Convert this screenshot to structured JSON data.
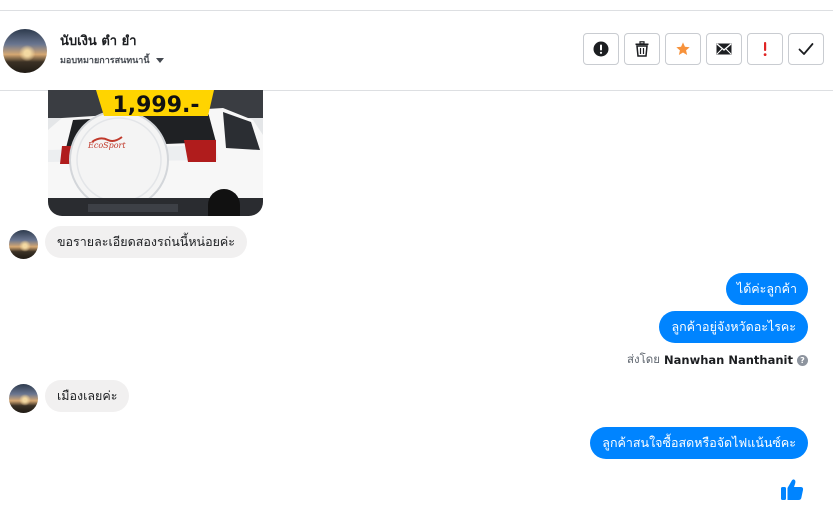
{
  "header": {
    "contact_name": "นับเงิน ตำ ยำ",
    "assign_label": "มอบหมายการสนทนานี้",
    "actions": [
      {
        "name": "mark-spam-button",
        "icon": "exclamation-circle-icon"
      },
      {
        "name": "delete-button",
        "icon": "trash-icon"
      },
      {
        "name": "star-button",
        "icon": "star-icon"
      },
      {
        "name": "mark-unread-button",
        "icon": "envelope-icon"
      },
      {
        "name": "follow-up-button",
        "icon": "exclamation-icon"
      },
      {
        "name": "mark-done-button",
        "icon": "checkmark-icon"
      }
    ]
  },
  "image_message": {
    "price_text": "1,999.-"
  },
  "messages": [
    {
      "direction": "in",
      "text": "ขอรายละเอียดสองรถ่นนี้หน่อยค่ะ"
    },
    {
      "direction": "out",
      "text": "ได้ค่ะลูกค้า"
    },
    {
      "direction": "out",
      "text": "ลูกค้าอยู่จังหวัดอะไรคะ"
    },
    {
      "direction": "in",
      "text": "เมืองเลยค่ะ"
    },
    {
      "direction": "out",
      "text": "ลูกค้าสนใจซื้อสดหรือจัดไฟแน้นซ์คะ"
    }
  ],
  "sent_by": {
    "prefix": "ส่งโดย",
    "name": "Nanwhan Nanthanit",
    "help": "?"
  },
  "colors": {
    "accent": "#0084ff",
    "incoming_bubble": "#f1f0f0",
    "star": "#f7923b",
    "follow_up": "#e02424",
    "price_tag": "#ffd400"
  }
}
